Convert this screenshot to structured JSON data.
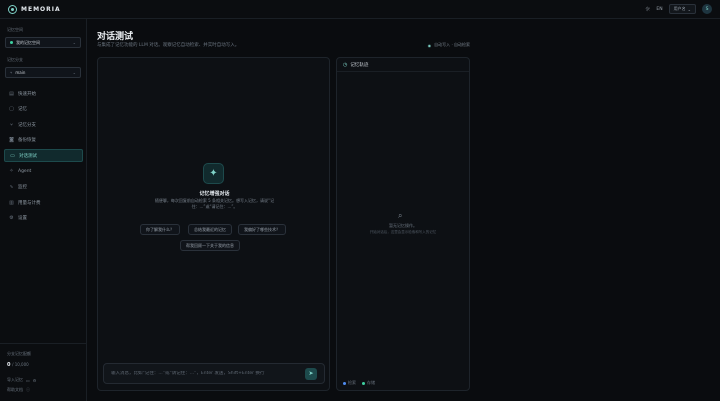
{
  "topbar": {
    "brand": "MEMORIA",
    "lang": "EN",
    "user_label": "用户名",
    "avatar": "S",
    "icons": {
      "logo": "memoria-logo-icon",
      "theme": "sun-icon",
      "chevron": "chevron-down-icon"
    }
  },
  "sidebar": {
    "space_label": "记忆空间",
    "space_value": "我的记忆空间",
    "branch_label": "记忆分支",
    "branch_value": "main",
    "items": [
      {
        "label": "快速开始",
        "icon": "book-icon",
        "active": false
      },
      {
        "label": "记忆",
        "icon": "document-icon",
        "active": false
      },
      {
        "label": "记忆分支",
        "icon": "branch-icon",
        "active": false
      },
      {
        "label": "备份恢复",
        "icon": "camera-icon",
        "active": false
      },
      {
        "label": "对话测试",
        "icon": "chat-icon",
        "active": true
      },
      {
        "label": "Agent",
        "icon": "sparkle-icon",
        "active": false
      },
      {
        "label": "监控",
        "icon": "activity-icon",
        "active": false
      },
      {
        "label": "用量与计费",
        "icon": "bar-chart-icon",
        "active": false
      },
      {
        "label": "设置",
        "icon": "gear-icon",
        "active": false
      }
    ],
    "bottom_label": "分支记忆配额",
    "mem_used": "0",
    "mem_total": "/ 10,000",
    "import_label": "导入记忆",
    "help_label": "帮助文档"
  },
  "main": {
    "title": "对话测试",
    "subtitle": "与集成了记忆功能的 LLM 对话。观察记忆自动检索、并实时自动写入。",
    "header_right": "自动写入 · 自动检索",
    "empty_title": "记忆增强对话",
    "empty_desc": "随便聊，每次回复前自动检索 5 条相关记忆。想写入记忆，请说“记住：...”或“请记住：...”。",
    "suggestions": [
      "你了解我什么？",
      "总结我最近的记忆",
      "我偏好了哪些技术？",
      "帮我回顾一下关于我的信息"
    ],
    "composer_placeholder": "输入消息，比如“记住：...”或“请记住：...”，Enter 发送，Shift+Enter 换行",
    "trace_title": "记忆轨迹",
    "trace_empty_title": "暂无记忆操作。",
    "trace_empty_sub": "开始对话后，这里会显示检索和写入的记忆",
    "legend_retrieve": "检索",
    "legend_store": "存储"
  },
  "colors": {
    "accent": "#7fd3c8",
    "retrieve": "#4f8cf0",
    "store": "#3ed0a0"
  }
}
